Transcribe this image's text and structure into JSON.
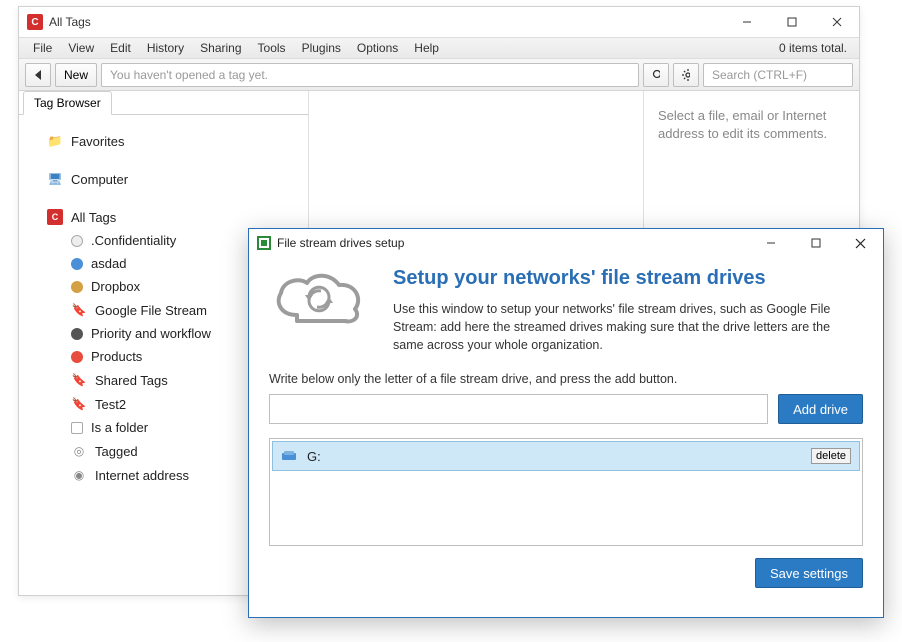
{
  "titlebar": {
    "app_letter": "C",
    "title": "All Tags"
  },
  "menubar": {
    "items": [
      "File",
      "View",
      "Edit",
      "History",
      "Sharing",
      "Tools",
      "Plugins",
      "Options",
      "Help"
    ],
    "status": "0 items total."
  },
  "toolbar": {
    "new_label": "New",
    "address_placeholder": "You haven't opened a tag yet.",
    "search_placeholder": "Search (CTRL+F)"
  },
  "sidebar": {
    "tab_label": "Tag Browser",
    "favorites": "Favorites",
    "computer": "Computer",
    "all_tags": "All Tags",
    "children": [
      {
        "icon": "dot-grey",
        "label": ".Confidentiality"
      },
      {
        "icon": "dot-blue",
        "label": "asdad"
      },
      {
        "icon": "dot-green",
        "label": "Dropbox"
      },
      {
        "icon": "tag-blue",
        "label": "Google File Stream"
      },
      {
        "icon": "dot-dark",
        "label": "Priority and workflow"
      },
      {
        "icon": "dot-red",
        "label": "Products"
      },
      {
        "icon": "tag-blue",
        "label": "Shared Tags"
      },
      {
        "icon": "tag-blue",
        "label": "Test2"
      },
      {
        "icon": "folder-out",
        "label": "Is a folder"
      },
      {
        "icon": "tagged",
        "label": "Tagged"
      },
      {
        "icon": "globe",
        "label": "Internet address"
      }
    ]
  },
  "right_panel": {
    "hint": "Select a file, email or Internet address to edit its comments."
  },
  "dialog": {
    "title": "File stream drives setup",
    "heading": "Setup your networks' file stream drives",
    "description": "Use this window to setup your networks' file stream drives, such as Google File Stream: add here the streamed drives making sure that the drive letters  are the same across your whole organization.",
    "instruction": "Write below only the letter of a file stream drive, and press the add button.",
    "add_button": "Add drive",
    "drives": [
      {
        "name": "G:"
      }
    ],
    "delete_label": "delete",
    "save_button": "Save settings"
  }
}
